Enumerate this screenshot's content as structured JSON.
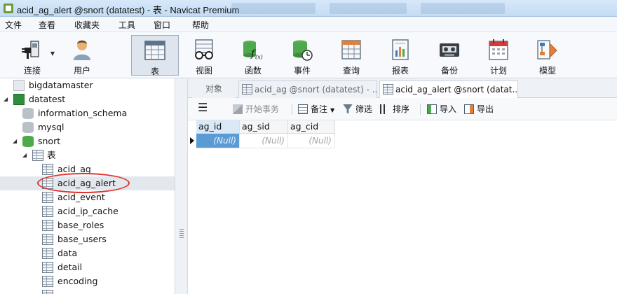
{
  "window": {
    "title": "acid_ag_alert @snort (datatest) - 表 - Navicat Premium"
  },
  "menu": [
    "文件",
    "查看",
    "收藏夹",
    "工具",
    "窗口",
    "帮助"
  ],
  "toolbar": {
    "connect": "连接",
    "user": "用户",
    "table": "表",
    "view": "视图",
    "function": "函数",
    "event": "事件",
    "query": "查询",
    "report": "报表",
    "backup": "备份",
    "schedule": "计划",
    "model": "模型"
  },
  "tree": {
    "conn1": "bigdatamaster",
    "conn2": "datatest",
    "db1": "information_schema",
    "db2": "mysql",
    "db3": "snort",
    "tables_folder": "表",
    "tables": [
      "acid_ag",
      "acid_ag_alert",
      "acid_event",
      "acid_ip_cache",
      "base_roles",
      "base_users",
      "data",
      "detail",
      "encoding"
    ]
  },
  "tabs": {
    "objects": "对象",
    "tab1": "acid_ag @snort (datatest) - ...",
    "tab2": "acid_ag_alert @snort (datat..."
  },
  "subtoolbar": {
    "begin_tx": "开始事务",
    "note": "备注",
    "filter": "筛选",
    "sort": "排序",
    "import": "导入",
    "export": "导出"
  },
  "grid": {
    "columns": [
      "ag_id",
      "ag_sid",
      "ag_cid"
    ],
    "row": [
      "(Null)",
      "(Null)",
      "(Null)"
    ]
  },
  "colors": {
    "selection": "#5b9bd5",
    "annotation": "#e2322c",
    "accent_green": "#4ea84c"
  }
}
